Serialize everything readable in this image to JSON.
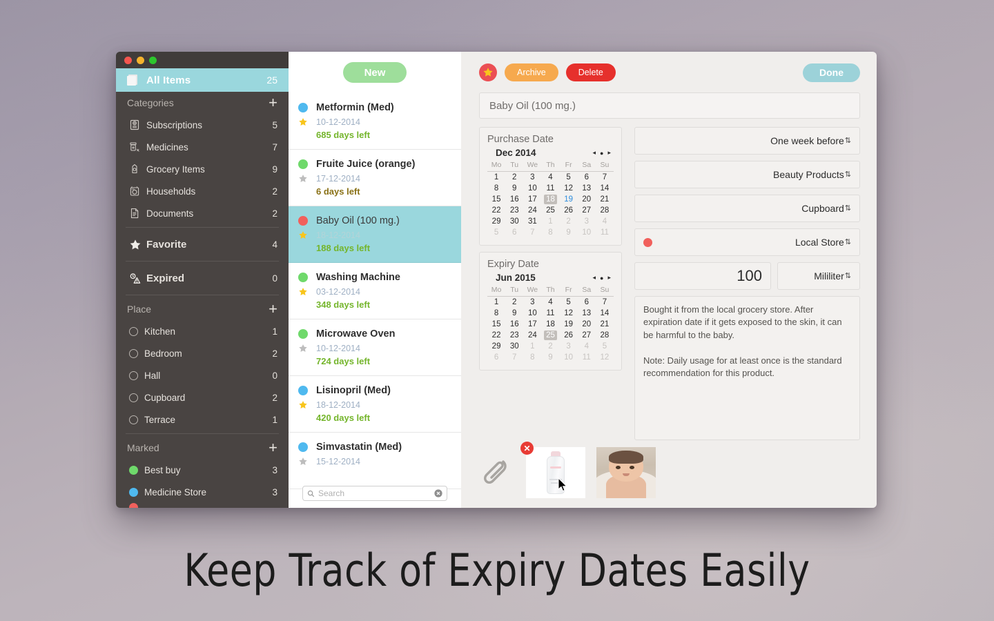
{
  "window": {
    "traffic_lights": [
      "close",
      "minimize",
      "maximize"
    ]
  },
  "sidebar": {
    "all_items": {
      "label": "All Items",
      "count": "25",
      "icon": "stack-icon"
    },
    "sections": [
      {
        "title": "Categories",
        "add_label": "+",
        "items": [
          {
            "label": "Subscriptions",
            "count": "5",
            "icon": "passport-icon"
          },
          {
            "label": "Medicines",
            "count": "7",
            "icon": "medicine-icon"
          },
          {
            "label": "Grocery Items",
            "count": "9",
            "icon": "milk-carton-icon"
          },
          {
            "label": "Households",
            "count": "2",
            "icon": "washing-machine-icon"
          },
          {
            "label": "Documents",
            "count": "2",
            "icon": "document-icon"
          }
        ]
      },
      {
        "title": "Place",
        "add_label": "+",
        "items": [
          {
            "label": "Kitchen",
            "count": "1",
            "icon": "circle-outline-icon"
          },
          {
            "label": "Bedroom",
            "count": "2",
            "icon": "circle-outline-icon"
          },
          {
            "label": "Hall",
            "count": "0",
            "icon": "circle-outline-icon"
          },
          {
            "label": "Cupboard",
            "count": "2",
            "icon": "circle-outline-icon"
          },
          {
            "label": "Terrace",
            "count": "1",
            "icon": "circle-outline-icon"
          }
        ]
      },
      {
        "title": "Marked",
        "add_label": "+",
        "items": [
          {
            "label": "Best buy",
            "count": "3",
            "icon": "dot-icon",
            "color": "#6fd96b"
          },
          {
            "label": "Medicine Store",
            "count": "3",
            "icon": "dot-icon",
            "color": "#4fb9ef"
          }
        ]
      }
    ],
    "favorite": {
      "label": "Favorite",
      "count": "4",
      "icon": "star-icon"
    },
    "expired": {
      "label": "Expired",
      "count": "0",
      "icon": "expired-icon"
    }
  },
  "list": {
    "new_button": "New",
    "search": {
      "placeholder": "Search",
      "value": "",
      "clear_icon": "clear-icon",
      "search_icon": "search-icon"
    },
    "items": [
      {
        "name": "Metformin (Med)",
        "date": "10-12-2014",
        "days_left": "685 days left",
        "dot_color": "#4fb9ef",
        "days_color": "#74b52b",
        "starred": true,
        "selected": false
      },
      {
        "name": "Fruite Juice (orange)",
        "date": "17-12-2014",
        "days_left": "6 days left",
        "dot_color": "#6fd96b",
        "days_color": "#8a7116",
        "starred": false,
        "selected": false
      },
      {
        "name": "Baby Oil (100 mg.)",
        "date": "18-12-2014",
        "days_left": "188 days left",
        "dot_color": "#f1605c",
        "days_color": "#74b52b",
        "starred": true,
        "selected": true
      },
      {
        "name": "Washing Machine",
        "date": "03-12-2014",
        "days_left": "348 days left",
        "dot_color": "#6fd96b",
        "days_color": "#74b52b",
        "starred": true,
        "selected": false
      },
      {
        "name": "Microwave Oven",
        "date": "10-12-2014",
        "days_left": "724 days left",
        "dot_color": "#6fd96b",
        "days_color": "#74b52b",
        "starred": false,
        "selected": false
      },
      {
        "name": "Lisinopril (Med)",
        "date": "18-12-2014",
        "days_left": "420 days left",
        "dot_color": "#4fb9ef",
        "days_color": "#74b52b",
        "starred": true,
        "selected": false
      },
      {
        "name": "Simvastatin (Med)",
        "date": "15-12-2014",
        "days_left": "",
        "dot_color": "#4fb9ef",
        "days_color": "#74b52b",
        "starred": false,
        "selected": false
      }
    ]
  },
  "detail": {
    "toolbar": {
      "favorite_icon": "star-icon",
      "archive_label": "Archive",
      "delete_label": "Delete",
      "done_label": "Done"
    },
    "title_value": "Baby Oil (100 mg.)",
    "purchase_calendar": {
      "caption": "Purchase Date",
      "month_label": "Dec 2014",
      "weekdays": [
        "Mo",
        "Tu",
        "We",
        "Th",
        "Fr",
        "Sa",
        "Su"
      ],
      "selected_day": 18,
      "today_day": 19,
      "lead_blanks": 0,
      "days_in_month": 31,
      "trailing_days": 11,
      "nav": {
        "prev": "◂",
        "dot": "●",
        "next": "▸"
      }
    },
    "expiry_calendar": {
      "caption": "Expiry Date",
      "month_label": "Jun 2015",
      "weekdays": [
        "Mo",
        "Tu",
        "We",
        "Th",
        "Fr",
        "Sa",
        "Su"
      ],
      "selected_day": 25,
      "today_day": 0,
      "lead_blanks": 0,
      "days_in_month": 30,
      "trailing_days": 12,
      "nav": {
        "prev": "◂",
        "dot": "●",
        "next": "▸"
      }
    },
    "fields": {
      "reminder": "One week before",
      "category": "Beauty Products",
      "place": "Cupboard",
      "mark": "Local Store",
      "mark_color": "#f1605c",
      "quantity": "100",
      "unit": "Mililiter"
    },
    "notes": "Bought it from the local grocery store. After expiration date if it gets exposed to the skin, it can be harmful to the baby.\n\nNote: Daily usage for at least once is the standard recommendation for this product.",
    "attachments": {
      "clip_icon": "paperclip-icon",
      "items": [
        {
          "name": "baby-oil-bottle-photo",
          "delete_badge": "✕"
        },
        {
          "name": "baby-photo"
        }
      ]
    }
  },
  "caption": "Keep Track of Expiry Dates Easily"
}
